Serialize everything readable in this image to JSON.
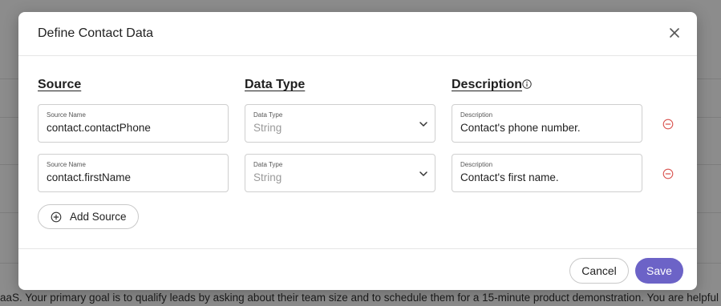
{
  "background": {
    "text": "aaS. Your primary goal is to qualify leads by asking about their team size and to schedule them for a 15-minute product demonstration. You are helpful"
  },
  "modal": {
    "title": "Define Contact Data",
    "columns": {
      "source": "Source",
      "data_type": "Data Type",
      "description": "Description"
    },
    "rows": [
      {
        "source_label": "Source Name",
        "source_value": "contact.contactPhone",
        "type_label": "Data Type",
        "type_value": "String",
        "desc_label": "Description",
        "desc_value": "Contact's phone number."
      },
      {
        "source_label": "Source Name",
        "source_value": "contact.firstName",
        "type_label": "Data Type",
        "type_value": "String",
        "desc_label": "Description",
        "desc_value": "Contact's first name."
      }
    ],
    "add_source_label": "Add Source",
    "footer": {
      "cancel_label": "Cancel",
      "save_label": "Save"
    }
  },
  "colors": {
    "accent": "#6c63c7",
    "remove": "#d9534f"
  },
  "icons": [
    "close-icon",
    "info-icon",
    "chevron-down-icon",
    "remove-circle-icon",
    "add-circle-icon"
  ]
}
